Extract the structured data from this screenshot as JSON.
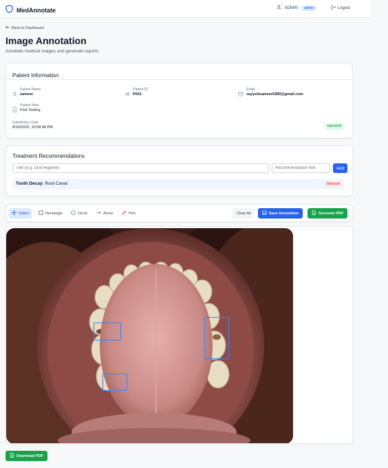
{
  "app": {
    "name": "MedAnnotate"
  },
  "user": {
    "name": "ADMIN",
    "role": "admin",
    "logout_label": "Logout"
  },
  "nav": {
    "back_label": "Back to Dashboard"
  },
  "page": {
    "title": "Image Annotation",
    "subtitle": "Annotate medical images and generate reports"
  },
  "patient": {
    "section_title": "Patient Information",
    "name_label": "Patient Name",
    "name": "sameer",
    "id_label": "Patient ID",
    "id": "P001",
    "email_label": "Email",
    "email": "sayyedsameer6280@gmail.com",
    "note_label": "Patient Note",
    "note": "First Testing",
    "date_label": "Submission Date",
    "date": "9/10/2025, 10:58:48 PM",
    "status": "reported"
  },
  "treatment": {
    "section_title": "Treatment Recommendations",
    "title_placeholder": "Title (e.g. Oral Hygiene)",
    "text_placeholder": "Recommendation text",
    "add_label": "Add",
    "items": [
      {
        "title": "Tooth Decay:",
        "text": "Root Canal",
        "remove_label": "Remove"
      }
    ]
  },
  "tools": {
    "select": "Select",
    "rectangle": "Rectangle",
    "circle": "Circle",
    "arrow": "Arrow",
    "pen": "Pen",
    "clear": "Clear All",
    "save": "Save Annotation",
    "generate": "Generate PDF"
  },
  "download_label": "Download PDF",
  "annotations": {
    "count": 3,
    "color": "#3b82f6"
  },
  "colors": {
    "primary": "#2563eb",
    "success": "#16a34a",
    "danger": "#dc2626"
  }
}
